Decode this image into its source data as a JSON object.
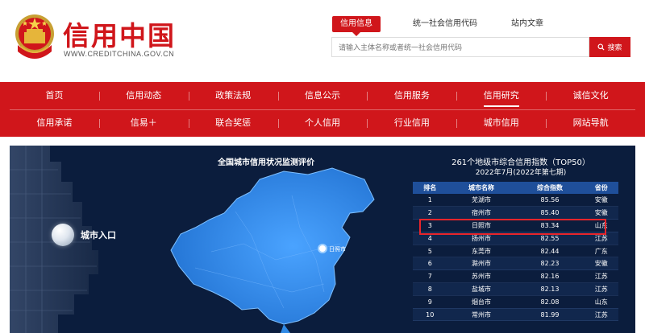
{
  "header": {
    "logo_title": "信用中国",
    "logo_url": "WWW.CREDITCHINA.GOV.CN",
    "search_tabs": [
      {
        "label": "信用信息",
        "active": true
      },
      {
        "label": "统一社会信用代码",
        "active": false
      },
      {
        "label": "站内文章",
        "active": false
      }
    ],
    "search_placeholder": "请输入主体名称或者统一社会信用代码",
    "search_button": "搜索"
  },
  "nav": {
    "row1": [
      "首页",
      "信用动态",
      "政策法规",
      "信息公示",
      "信用服务",
      "信用研究",
      "诚信文化"
    ],
    "row2": [
      "信用承诺",
      "信易＋",
      "联合奖惩",
      "个人信用",
      "行业信用",
      "城市信用",
      "网站导航"
    ],
    "active": "信用研究"
  },
  "banner": {
    "title": "全国城市信用状况监测评价",
    "city_entry": "城市入口",
    "map_label": "日照市",
    "rank_title": "261个地级市综合信用指数（TOP50）",
    "rank_subtitle": "2022年7月(2022年第七期)",
    "columns": [
      "排名",
      "城市名称",
      "综合指数",
      "省份"
    ],
    "rows": [
      [
        "1",
        "芜湖市",
        "85.56",
        "安徽"
      ],
      [
        "2",
        "宿州市",
        "85.40",
        "安徽"
      ],
      [
        "3",
        "日照市",
        "83.34",
        "山东"
      ],
      [
        "4",
        "扬州市",
        "82.55",
        "江苏"
      ],
      [
        "5",
        "东莞市",
        "82.44",
        "广东"
      ],
      [
        "6",
        "滁州市",
        "82.23",
        "安徽"
      ],
      [
        "7",
        "苏州市",
        "82.16",
        "江苏"
      ],
      [
        "8",
        "盐城市",
        "82.13",
        "江苏"
      ],
      [
        "9",
        "烟台市",
        "82.08",
        "山东"
      ],
      [
        "10",
        "常州市",
        "81.99",
        "江苏"
      ]
    ]
  },
  "colors": {
    "brand_red": "#d0161b",
    "banner_bg": "#0b1d3d",
    "map_blue": "#2f8ae6",
    "table_header": "#1f4f9a"
  }
}
